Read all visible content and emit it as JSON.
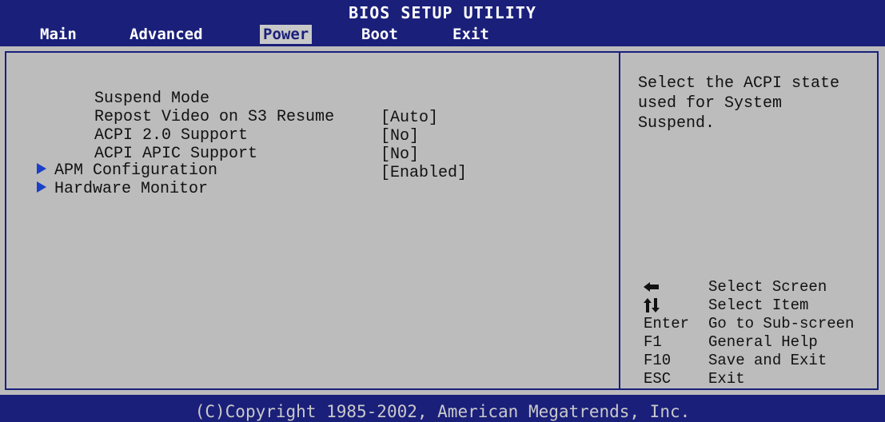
{
  "title": "BIOS SETUP UTILITY",
  "tabs": [
    {
      "label": "Main"
    },
    {
      "label": "Advanced"
    },
    {
      "label": "Power"
    },
    {
      "label": "Boot"
    },
    {
      "label": "Exit"
    }
  ],
  "active_tab": "Power",
  "settings": [
    {
      "label": "Suspend Mode",
      "value": "[Auto]"
    },
    {
      "label": "Repost Video on S3 Resume",
      "value": "[No]"
    },
    {
      "label": "ACPI 2.0 Support",
      "value": "[No]"
    },
    {
      "label": "ACPI APIC Support",
      "value": "[Enabled]"
    }
  ],
  "submenus": [
    {
      "label": "APM Configuration"
    },
    {
      "label": "Hardware Monitor"
    }
  ],
  "help_lines": [
    "Select the ACPI state",
    "used for System",
    "Suspend."
  ],
  "keys": [
    {
      "key": "",
      "icon": "left-right-arrow-icon",
      "desc": "Select Screen"
    },
    {
      "key": "",
      "icon": "up-down-arrow-icon",
      "desc": "Select Item"
    },
    {
      "key": "Enter",
      "desc": "Go to Sub-screen"
    },
    {
      "key": "F1",
      "desc": "General Help"
    },
    {
      "key": "F10",
      "desc": "Save and Exit"
    },
    {
      "key": "ESC",
      "desc": "Exit"
    }
  ],
  "footer": "(C)Copyright 1985-2002, American Megatrends, Inc.",
  "colors": {
    "background": "#1a1f7a",
    "panel": "#bcbcbc",
    "highlight": "#1a3fc8"
  }
}
